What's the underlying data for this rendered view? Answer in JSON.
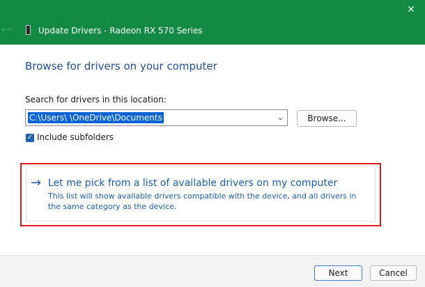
{
  "window": {
    "title": "Update Drivers - Radeon RX 570 Series",
    "close_glyph": "✕",
    "back_glyph": "⟵",
    "titlebar_color": "#138a43"
  },
  "page": {
    "heading": "Browse for drivers on your computer",
    "search_label": "Search for drivers in this location:",
    "path_value": "C:\\Users\\          \\OneDrive\\Documents",
    "combo_chevron": "⌄",
    "browse_label": "Browse...",
    "include_subfolders": {
      "label": "Include subfolders",
      "checked": true,
      "glyph": "✓"
    }
  },
  "pick_option": {
    "arrow_glyph": "→",
    "title": "Let me pick from a list of available drivers on my computer",
    "description": "This list will show available drivers compatible with the device, and all drivers in the same category as the device.",
    "highlight_color": "#e01b1b"
  },
  "footer": {
    "next_label": "Next",
    "cancel_label": "Cancel"
  },
  "icons": {
    "close": "close-icon",
    "back": "back-arrow-icon",
    "device": "device-icon",
    "chevron": "chevron-down-icon",
    "check": "checkmark-icon",
    "arrow": "arrow-right-icon"
  },
  "colors": {
    "accent": "#1a5fb4",
    "heading": "#1f4e9e",
    "selection": "#0a64d8"
  }
}
